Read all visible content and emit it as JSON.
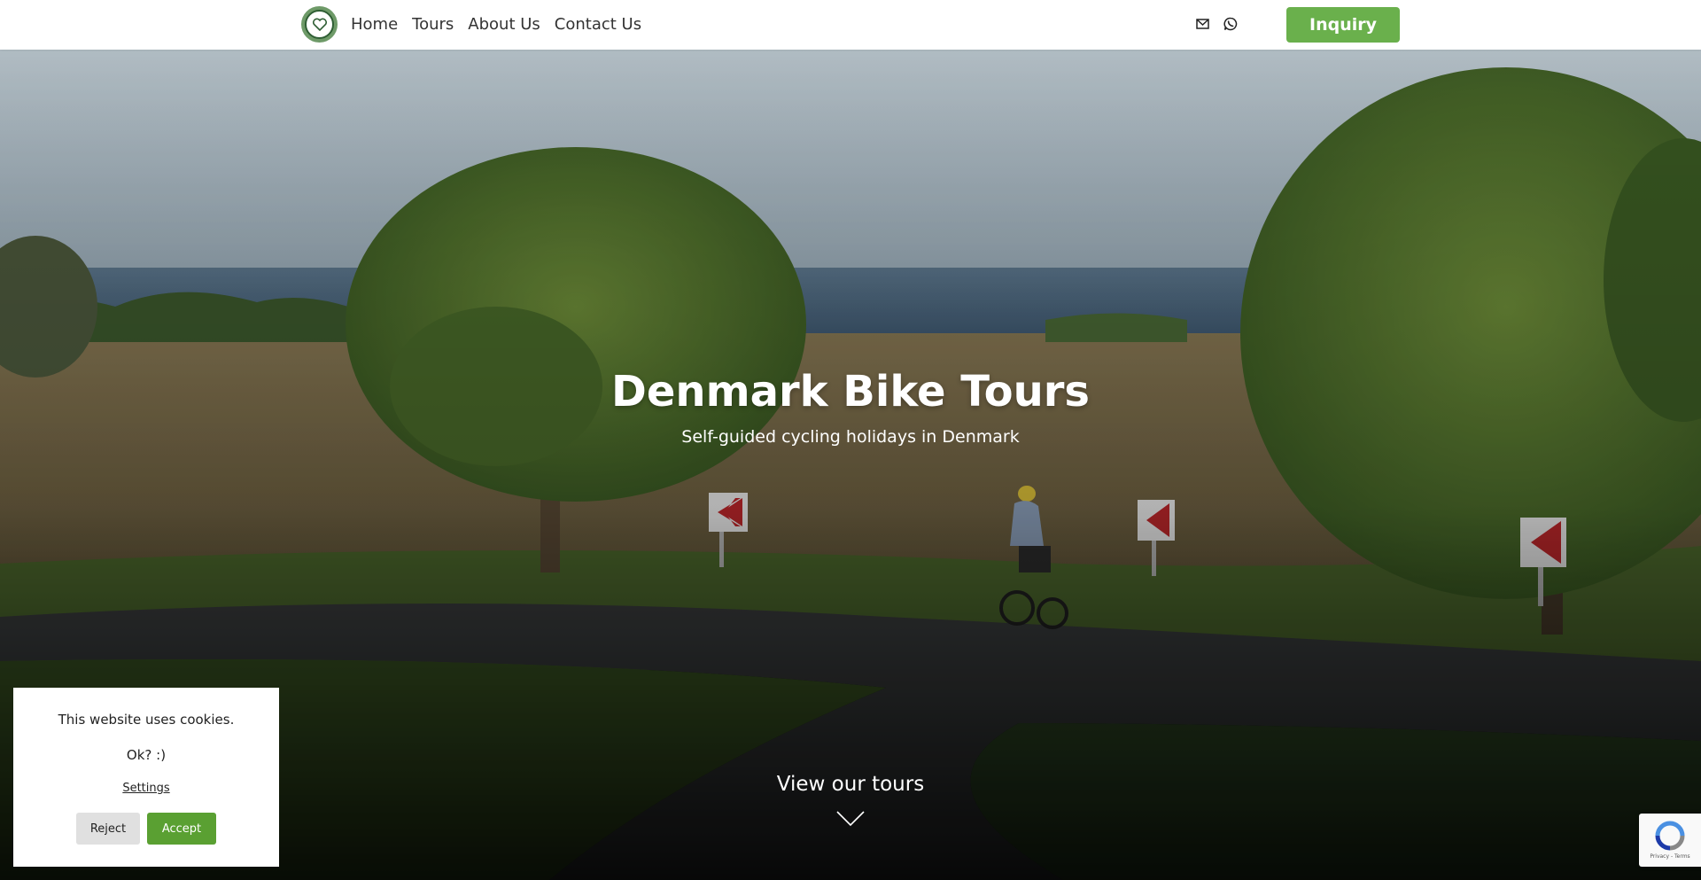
{
  "header": {
    "nav": [
      {
        "label": "Home"
      },
      {
        "label": "Tours"
      },
      {
        "label": "About Us"
      },
      {
        "label": "Contact Us"
      }
    ],
    "icons": [
      "mail-icon",
      "whatsapp-icon"
    ],
    "inquiry_label": "Inquiry",
    "accent_color": "#6ab04c"
  },
  "hero": {
    "title": "Denmark Bike Tours",
    "subtitle": "Self-guided cycling holidays in Denmark",
    "cta": "View our tours"
  },
  "cookie_banner": {
    "message": "This website uses cookies.",
    "question": "Ok? :)",
    "settings_label": "Settings",
    "reject_label": "Reject",
    "accept_label": "Accept"
  },
  "recaptcha": {
    "footer": "Privacy - Terms"
  }
}
